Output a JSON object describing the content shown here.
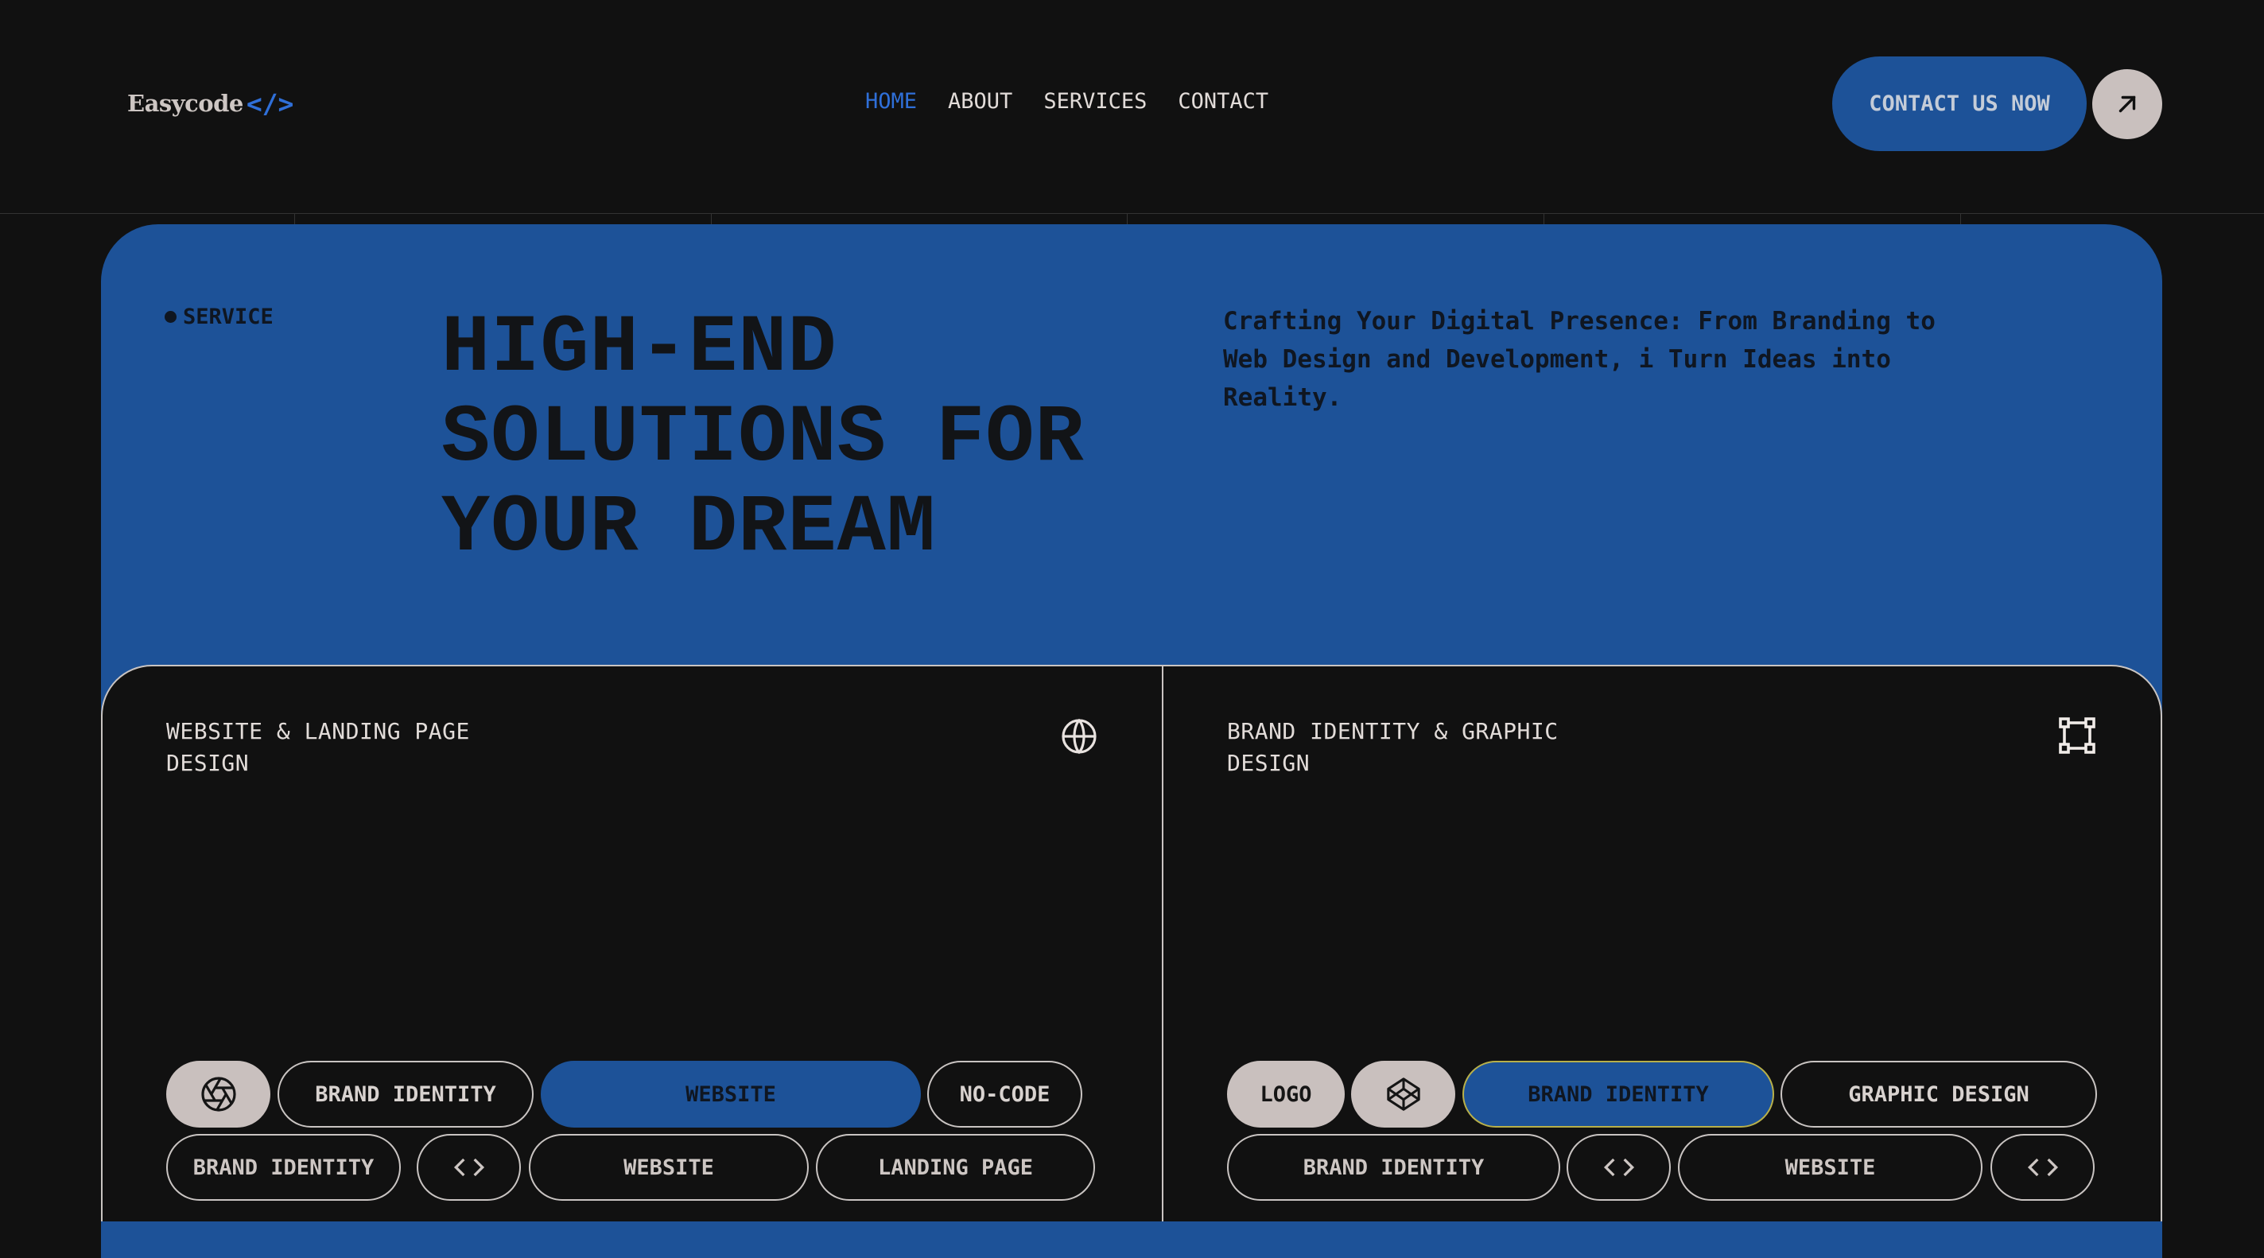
{
  "brand": {
    "name": "Easycode",
    "code_mark": "</>",
    "accent": "#2f6fd8",
    "logo_icon": "code-brackets"
  },
  "nav": {
    "items": [
      {
        "label": "HOME",
        "active": true
      },
      {
        "label": "ABOUT",
        "active": false
      },
      {
        "label": "SERVICES",
        "active": false
      },
      {
        "label": "CONTACT",
        "active": false
      }
    ]
  },
  "header": {
    "cta_label": "CONTACT US NOW",
    "arrow_icon": "arrow-up-right-icon"
  },
  "hero": {
    "section_label": "SERVICE",
    "title_lines": [
      "HIGH-END",
      "SOLUTIONS FOR",
      "YOUR DREAM"
    ],
    "description": "Crafting Your Digital Presence: From Branding to Web Design and Development, i Turn Ideas into Reality.",
    "background_color": "#1d5298"
  },
  "cards": [
    {
      "title": "WEBSITE & LANDING PAGE DESIGN",
      "icon": "globe-icon",
      "chips_row1": [
        {
          "label": "",
          "icon": "aperture-icon",
          "style": "light"
        },
        {
          "label": "BRAND IDENTITY",
          "style": "outline"
        },
        {
          "label": "WEBSITE",
          "style": "blue"
        },
        {
          "label": "NO-CODE",
          "style": "outline"
        }
      ],
      "chips_row2": [
        {
          "label": "BRAND IDENTITY",
          "style": "outline"
        },
        {
          "label": "",
          "icon": "code-icon",
          "style": "outline"
        },
        {
          "label": "WEBSITE",
          "style": "outline"
        },
        {
          "label": "LANDING PAGE",
          "style": "outline"
        }
      ]
    },
    {
      "title": "BRAND IDENTITY & GRAPHIC DESIGN",
      "icon": "frame-select-icon",
      "chips_row1": [
        {
          "label": "LOGO",
          "style": "light"
        },
        {
          "label": "",
          "icon": "codepen-icon",
          "style": "light"
        },
        {
          "label": "BRAND IDENTITY",
          "style": "blue-outlined"
        },
        {
          "label": "GRAPHIC DESIGN",
          "style": "outline"
        }
      ],
      "chips_row2": [
        {
          "label": "BRAND IDENTITY",
          "style": "outline"
        },
        {
          "label": "",
          "icon": "code-icon",
          "style": "outline"
        },
        {
          "label": "WEBSITE",
          "style": "outline"
        },
        {
          "label": "",
          "icon": "code-icon",
          "style": "outline"
        }
      ]
    }
  ]
}
